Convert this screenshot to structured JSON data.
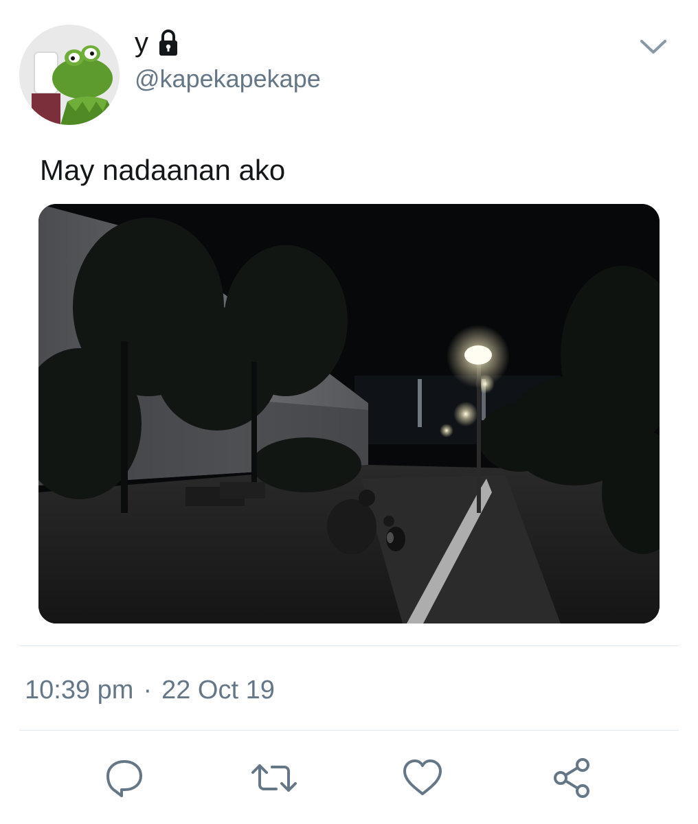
{
  "tweet": {
    "display_name": "y",
    "handle": "@kapekapekape",
    "text": "May nadaanan ako",
    "time": "10:39 pm",
    "separator": "·",
    "date": "22 Oct 19"
  },
  "icons": {
    "lock": "lock-icon",
    "menu": "chevron-down-icon",
    "reply": "reply-icon",
    "retweet": "retweet-icon",
    "like": "heart-icon",
    "share": "share-icon"
  },
  "colors": {
    "text": "#14171a",
    "secondary": "#657786",
    "divider": "#e1e8ed",
    "icon": "#657786"
  }
}
